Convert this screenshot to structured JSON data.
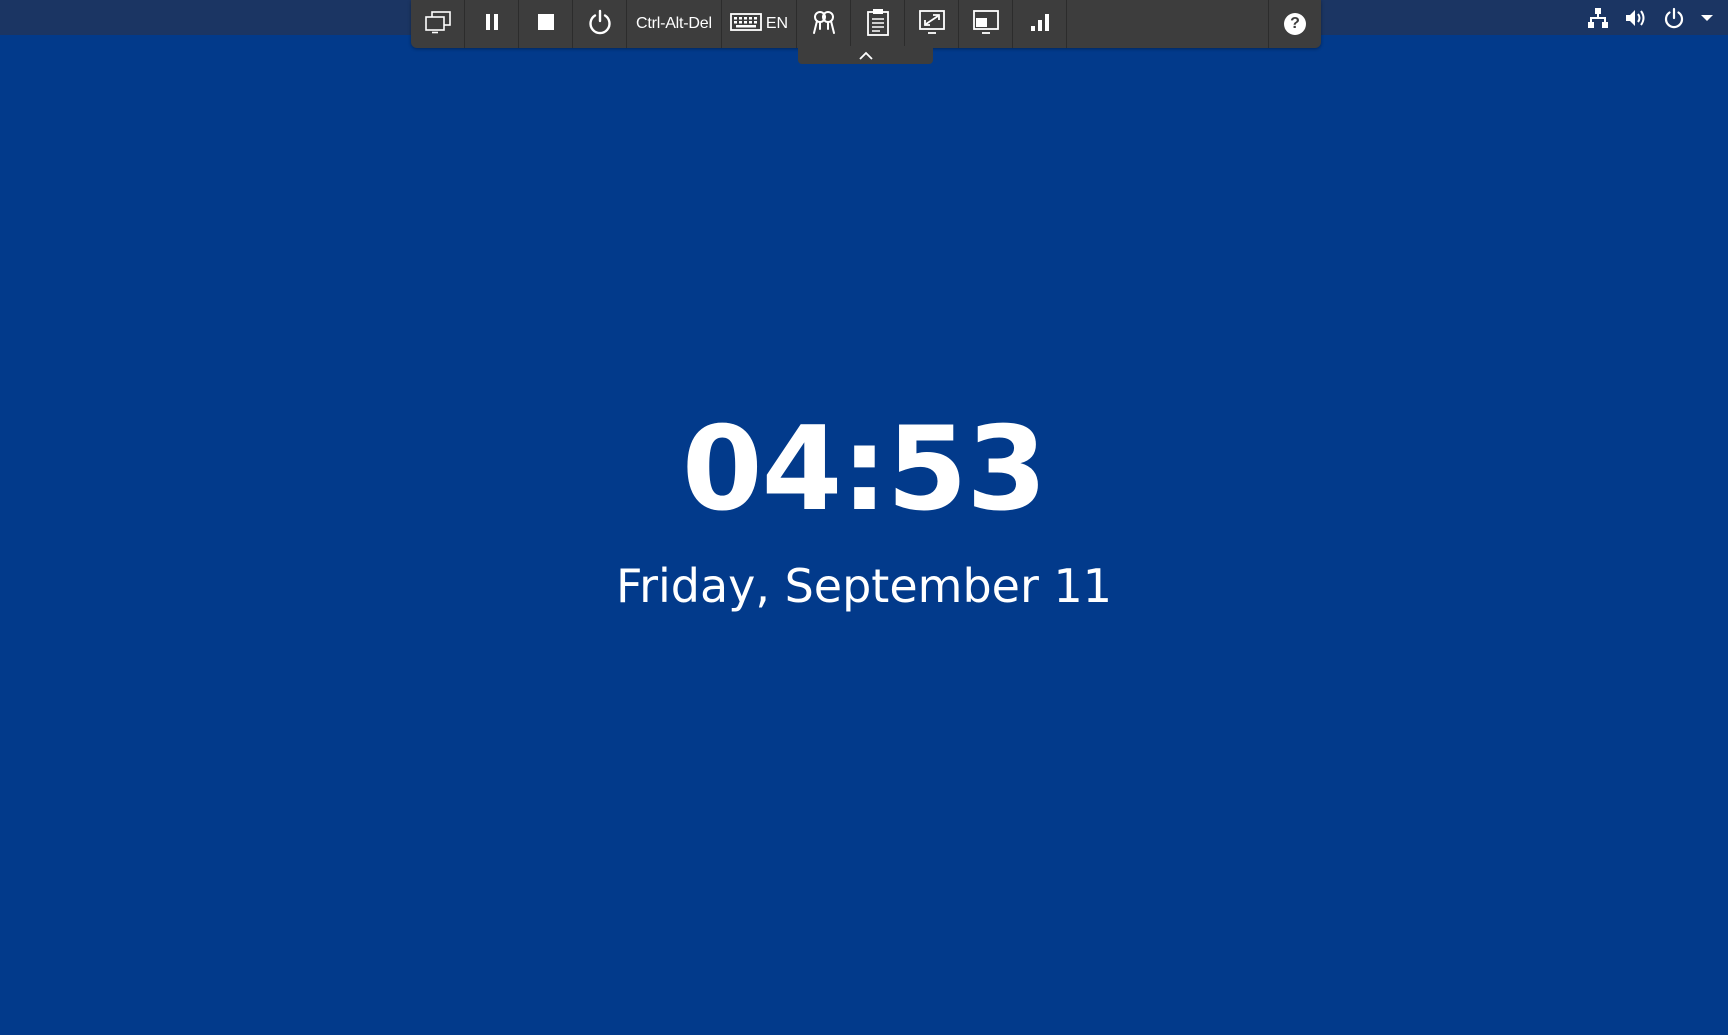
{
  "toolbar": {
    "ctrl_alt_del_label": "Ctrl-Alt-Del",
    "keyboard_layout_label": "EN",
    "help_label": "?",
    "buttons": [
      "switch-display-icon",
      "pause-icon",
      "stop-icon",
      "power-icon",
      "keyboard-icon",
      "credentials-icon",
      "clipboard-icon",
      "fullscreen-icon",
      "scale-display-icon",
      "connection-quality-icon"
    ]
  },
  "system_tray": {
    "icons": [
      "network-icon",
      "volume-icon",
      "power-icon",
      "menu-arrow-icon"
    ]
  },
  "lock_screen": {
    "time": "04:53",
    "date": "Friday, September 11"
  },
  "colors": {
    "desktop_background": "#023a8b",
    "top_bar": "#1b3563",
    "toolbar": "#3d3d3d",
    "text": "#ffffff"
  }
}
